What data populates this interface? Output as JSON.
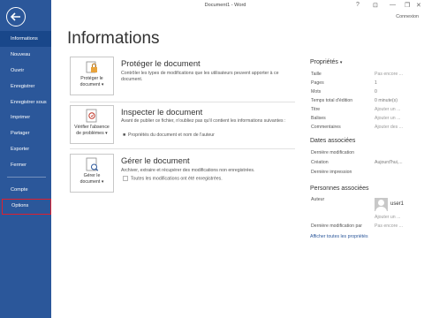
{
  "window": {
    "title": "Document1 - Word",
    "help": "?",
    "ribbon_toggle": "⊡",
    "minimize": "—",
    "restore": "❐",
    "close": "✕",
    "signin": "Connexion"
  },
  "sidebar": {
    "back_icon": "←",
    "items": [
      {
        "label": "Informations"
      },
      {
        "label": "Nouveau"
      },
      {
        "label": "Ouvrir"
      },
      {
        "label": "Enregistrer"
      },
      {
        "label": "Enregistrer sous"
      },
      {
        "label": "Imprimer"
      },
      {
        "label": "Partager"
      },
      {
        "label": "Exporter"
      },
      {
        "label": "Fermer"
      },
      {
        "label": "Compte"
      },
      {
        "label": "Options"
      }
    ]
  },
  "main": {
    "title": "Informations",
    "cards": [
      {
        "button_line1": "Protéger le",
        "button_line2": "document",
        "caret": "▾",
        "title": "Protéger le document",
        "description": "Contrôler les types de modifications que les utilisateurs peuvent apporter à ce document."
      },
      {
        "button_line1": "Vérifier l'absence",
        "button_line2": "de problèmes",
        "caret": "▾",
        "title": "Inspecter le document",
        "description": "Avant de publier ce fichier, n'oubliez pas qu'il contient les informations suivantes :",
        "bullet": "Propriétés du document et nom de l'auteur"
      },
      {
        "button_line1": "Gérer le",
        "button_line2": "document",
        "caret": "▾",
        "title": "Gérer le document",
        "description": "Archiver, extraire et récupérer des modifications non enregistrées.",
        "bullet": "Toutes les modifications ont été enregistrées."
      }
    ]
  },
  "properties": {
    "heading": "Propriétés",
    "caret": "▾",
    "rows": [
      {
        "label": "Taille",
        "value": "Pas encore ..."
      },
      {
        "label": "Pages",
        "value": "1"
      },
      {
        "label": "Mots",
        "value": "0"
      },
      {
        "label": "Temps total d'édition",
        "value": "0 minute(s)"
      },
      {
        "label": "Titre",
        "value": "Ajouter un ..."
      },
      {
        "label": "Balises",
        "value": "Ajouter un ..."
      },
      {
        "label": "Commentaires",
        "value": "Ajouter des ..."
      }
    ],
    "dates_heading": "Dates associées",
    "dates": [
      {
        "label": "Dernière modification",
        "value": ""
      },
      {
        "label": "Création",
        "value": "Aujourd'hui,..."
      },
      {
        "label": "Dernière impression",
        "value": ""
      }
    ],
    "people_heading": "Personnes associées",
    "author_label": "Auteur",
    "author_name": "user1",
    "add_author": "Ajouter un ...",
    "last_modified_by_label": "Dernière modification par",
    "last_modified_by_value": "Pas encore ...",
    "show_all_link": "Afficher toutes les propriétés"
  },
  "colors": {
    "sidebar": "#2b579a",
    "active_item": "#19478a",
    "highlight_border": "#e0202d"
  }
}
